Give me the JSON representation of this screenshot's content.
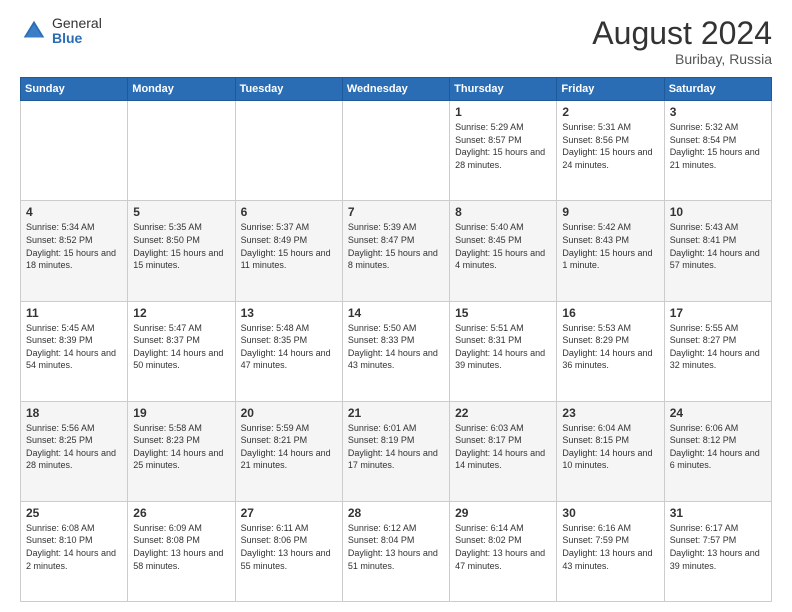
{
  "logo": {
    "general": "General",
    "blue": "Blue"
  },
  "header": {
    "month": "August 2024",
    "location": "Buribay, Russia"
  },
  "weekdays": [
    "Sunday",
    "Monday",
    "Tuesday",
    "Wednesday",
    "Thursday",
    "Friday",
    "Saturday"
  ],
  "weeks": [
    [
      {
        "day": "",
        "info": ""
      },
      {
        "day": "",
        "info": ""
      },
      {
        "day": "",
        "info": ""
      },
      {
        "day": "",
        "info": ""
      },
      {
        "day": "1",
        "info": "Sunrise: 5:29 AM\nSunset: 8:57 PM\nDaylight: 15 hours\nand 28 minutes."
      },
      {
        "day": "2",
        "info": "Sunrise: 5:31 AM\nSunset: 8:56 PM\nDaylight: 15 hours\nand 24 minutes."
      },
      {
        "day": "3",
        "info": "Sunrise: 5:32 AM\nSunset: 8:54 PM\nDaylight: 15 hours\nand 21 minutes."
      }
    ],
    [
      {
        "day": "4",
        "info": "Sunrise: 5:34 AM\nSunset: 8:52 PM\nDaylight: 15 hours\nand 18 minutes."
      },
      {
        "day": "5",
        "info": "Sunrise: 5:35 AM\nSunset: 8:50 PM\nDaylight: 15 hours\nand 15 minutes."
      },
      {
        "day": "6",
        "info": "Sunrise: 5:37 AM\nSunset: 8:49 PM\nDaylight: 15 hours\nand 11 minutes."
      },
      {
        "day": "7",
        "info": "Sunrise: 5:39 AM\nSunset: 8:47 PM\nDaylight: 15 hours\nand 8 minutes."
      },
      {
        "day": "8",
        "info": "Sunrise: 5:40 AM\nSunset: 8:45 PM\nDaylight: 15 hours\nand 4 minutes."
      },
      {
        "day": "9",
        "info": "Sunrise: 5:42 AM\nSunset: 8:43 PM\nDaylight: 15 hours\nand 1 minute."
      },
      {
        "day": "10",
        "info": "Sunrise: 5:43 AM\nSunset: 8:41 PM\nDaylight: 14 hours\nand 57 minutes."
      }
    ],
    [
      {
        "day": "11",
        "info": "Sunrise: 5:45 AM\nSunset: 8:39 PM\nDaylight: 14 hours\nand 54 minutes."
      },
      {
        "day": "12",
        "info": "Sunrise: 5:47 AM\nSunset: 8:37 PM\nDaylight: 14 hours\nand 50 minutes."
      },
      {
        "day": "13",
        "info": "Sunrise: 5:48 AM\nSunset: 8:35 PM\nDaylight: 14 hours\nand 47 minutes."
      },
      {
        "day": "14",
        "info": "Sunrise: 5:50 AM\nSunset: 8:33 PM\nDaylight: 14 hours\nand 43 minutes."
      },
      {
        "day": "15",
        "info": "Sunrise: 5:51 AM\nSunset: 8:31 PM\nDaylight: 14 hours\nand 39 minutes."
      },
      {
        "day": "16",
        "info": "Sunrise: 5:53 AM\nSunset: 8:29 PM\nDaylight: 14 hours\nand 36 minutes."
      },
      {
        "day": "17",
        "info": "Sunrise: 5:55 AM\nSunset: 8:27 PM\nDaylight: 14 hours\nand 32 minutes."
      }
    ],
    [
      {
        "day": "18",
        "info": "Sunrise: 5:56 AM\nSunset: 8:25 PM\nDaylight: 14 hours\nand 28 minutes."
      },
      {
        "day": "19",
        "info": "Sunrise: 5:58 AM\nSunset: 8:23 PM\nDaylight: 14 hours\nand 25 minutes."
      },
      {
        "day": "20",
        "info": "Sunrise: 5:59 AM\nSunset: 8:21 PM\nDaylight: 14 hours\nand 21 minutes."
      },
      {
        "day": "21",
        "info": "Sunrise: 6:01 AM\nSunset: 8:19 PM\nDaylight: 14 hours\nand 17 minutes."
      },
      {
        "day": "22",
        "info": "Sunrise: 6:03 AM\nSunset: 8:17 PM\nDaylight: 14 hours\nand 14 minutes."
      },
      {
        "day": "23",
        "info": "Sunrise: 6:04 AM\nSunset: 8:15 PM\nDaylight: 14 hours\nand 10 minutes."
      },
      {
        "day": "24",
        "info": "Sunrise: 6:06 AM\nSunset: 8:12 PM\nDaylight: 14 hours\nand 6 minutes."
      }
    ],
    [
      {
        "day": "25",
        "info": "Sunrise: 6:08 AM\nSunset: 8:10 PM\nDaylight: 14 hours\nand 2 minutes."
      },
      {
        "day": "26",
        "info": "Sunrise: 6:09 AM\nSunset: 8:08 PM\nDaylight: 13 hours\nand 58 minutes."
      },
      {
        "day": "27",
        "info": "Sunrise: 6:11 AM\nSunset: 8:06 PM\nDaylight: 13 hours\nand 55 minutes."
      },
      {
        "day": "28",
        "info": "Sunrise: 6:12 AM\nSunset: 8:04 PM\nDaylight: 13 hours\nand 51 minutes."
      },
      {
        "day": "29",
        "info": "Sunrise: 6:14 AM\nSunset: 8:02 PM\nDaylight: 13 hours\nand 47 minutes."
      },
      {
        "day": "30",
        "info": "Sunrise: 6:16 AM\nSunset: 7:59 PM\nDaylight: 13 hours\nand 43 minutes."
      },
      {
        "day": "31",
        "info": "Sunrise: 6:17 AM\nSunset: 7:57 PM\nDaylight: 13 hours\nand 39 minutes."
      }
    ]
  ]
}
